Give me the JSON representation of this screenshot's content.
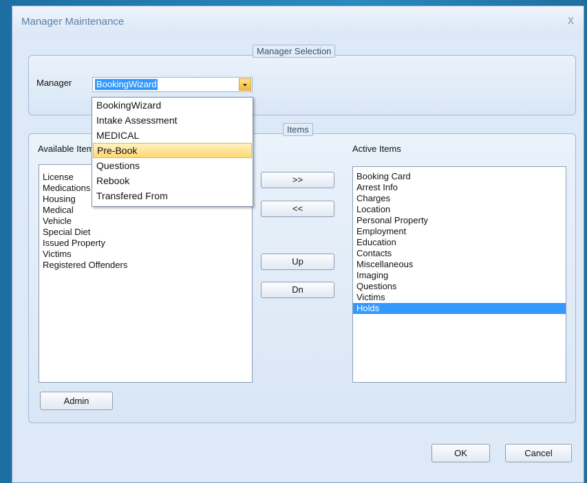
{
  "window": {
    "title": "Manager Maintenance",
    "close_glyph": "x"
  },
  "manager_selection": {
    "legend": "Manager Selection",
    "label": "Manager",
    "selected_value": "BookingWizard",
    "options": [
      "BookingWizard",
      "Intake Assessment",
      "MEDICAL",
      "Pre-Book",
      "Questions",
      "Rebook",
      "Transfered From"
    ],
    "highlighted_option": "Pre-Book"
  },
  "items": {
    "legend": "Items",
    "available_label": "Available Items",
    "active_label": "Active Items",
    "available_items": [
      "License",
      "Medications",
      "Housing",
      "Medical",
      "Vehicle",
      "Special Diet",
      "Issued Property",
      "Victims",
      "Registered Offenders"
    ],
    "active_items": [
      "Booking Card",
      "Arrest Info",
      "Charges",
      "Location",
      "Personal Property",
      "Employment",
      "Education",
      "Contacts",
      "Miscellaneous",
      "Imaging",
      "Questions",
      "Victims",
      "Holds"
    ],
    "active_selected": "Holds",
    "buttons": {
      "add": ">>",
      "remove": "<<",
      "up": "Up",
      "down": "Dn",
      "admin": "Admin"
    }
  },
  "footer": {
    "ok": "OK",
    "cancel": "Cancel"
  },
  "colors": {
    "selection": "#3399ff",
    "highlight": "#ffd971",
    "dialog_bg": "#dde9f6"
  }
}
